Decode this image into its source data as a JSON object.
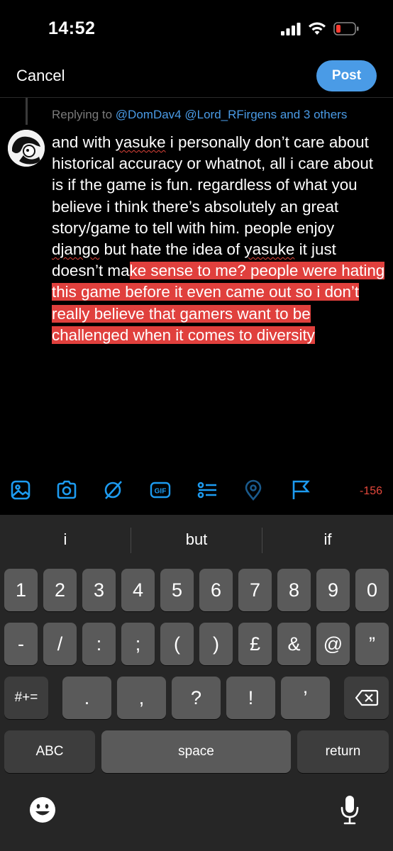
{
  "status_bar": {
    "time": "14:52"
  },
  "header": {
    "cancel_label": "Cancel",
    "post_label": "Post"
  },
  "reply": {
    "prefix": "Replying to",
    "mention1": "@DomDav4",
    "mention2": "@Lord_RFirgens",
    "suffix": "and 3 others"
  },
  "compose": {
    "p1": "and with ",
    "w1": "yasuke",
    "p2": " i personally don’t care about historical accuracy or whatnot, all i care about is if the game is fun. regardless of what you believe i think there’s absolutely an great story/game to tell with him. people enjoy ",
    "w2": "django",
    "p3": " but hate the idea of ",
    "w3": "yasuke",
    "p4": " it just doesn’t ma",
    "highlighted": "ke sense to me? people were hating this game before it even came out so i don’t really believe that gamers want to be challenged when it comes to diversity"
  },
  "toolbar": {
    "icons": [
      "image-icon",
      "camera-icon",
      "grok-icon",
      "gif-icon",
      "poll-icon",
      "location-icon",
      "flag-icon"
    ],
    "gif_label": "GIF",
    "char_counter": "-156"
  },
  "keyboard": {
    "suggestions": [
      "i",
      "but",
      "if"
    ],
    "row1": [
      "1",
      "2",
      "3",
      "4",
      "5",
      "6",
      "7",
      "8",
      "9",
      "0"
    ],
    "row2": [
      "-",
      "/",
      ":",
      ";",
      "(",
      ")",
      "£",
      "&",
      "@",
      "”"
    ],
    "row3": [
      ".",
      ",",
      "?",
      "!",
      "’"
    ],
    "symbols_label": "#+=",
    "abc_label": "ABC",
    "space_label": "space",
    "return_label": "return"
  },
  "colors": {
    "accent": "#4a9be6",
    "highlight": "#e0403d",
    "counter": "#e5483c",
    "toolbar_icon": "#1d9bf0"
  }
}
